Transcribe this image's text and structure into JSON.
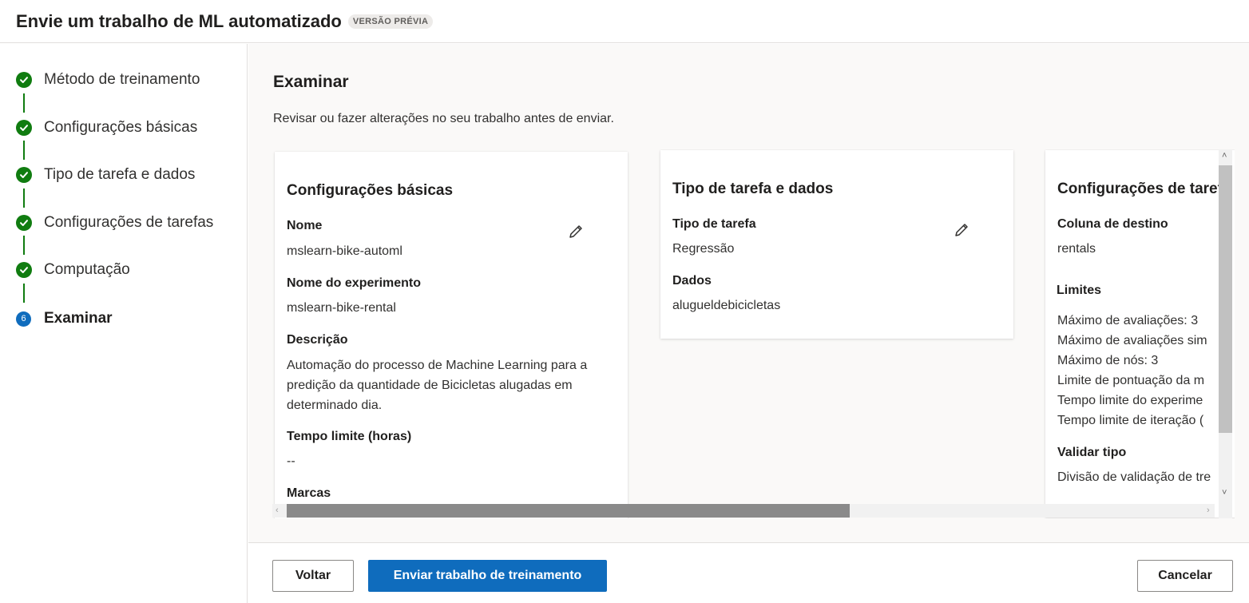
{
  "header": {
    "title": "Envie um trabalho de ML automatizado",
    "badge": "VERSÃO PRÉVIA"
  },
  "steps": [
    {
      "label": "Método de treinamento",
      "status": "done"
    },
    {
      "label": "Configurações básicas",
      "status": "done"
    },
    {
      "label": "Tipo de tarefa e dados",
      "status": "done"
    },
    {
      "label": "Configurações de tarefas",
      "status": "done"
    },
    {
      "label": "Computação",
      "status": "done"
    },
    {
      "label": "Examinar",
      "status": "current",
      "number": "6"
    }
  ],
  "main": {
    "title": "Examinar",
    "subtitle": "Revisar ou fazer alterações no seu trabalho antes de enviar."
  },
  "cards": {
    "basic": {
      "title": "Configurações básicas",
      "name_label": "Nome",
      "name_value": "mslearn-bike-automl",
      "experiment_label": "Nome do experimento",
      "experiment_value": "mslearn-bike-rental",
      "description_label": "Descrição",
      "description_value": "Automação do processo de Machine Learning para a predição da quantidade de Bicicletas alugadas em determinado dia.",
      "timeout_label": "Tempo limite (horas)",
      "timeout_value": "--",
      "tags_label": "Marcas"
    },
    "task": {
      "title": "Tipo de tarefa e dados",
      "type_label": "Tipo de tarefa",
      "type_value": "Regressão",
      "data_label": "Dados",
      "data_value": "alugueldebicicletas"
    },
    "settings": {
      "title": "Configurações de taref",
      "target_label": "Coluna de destino",
      "target_value": "rentals",
      "limits_label": "Limites",
      "limits": [
        "Máximo de avaliações: 3",
        "Máximo de avaliações sim",
        "Máximo de nós: 3",
        "Limite de pontuação da m",
        "Tempo limite do experime",
        "Tempo limite de iteração ("
      ],
      "validation_label": "Validar tipo",
      "validation_value": "Divisão de validação de tre"
    }
  },
  "footer": {
    "back_label": "Voltar",
    "submit_label": "Enviar trabalho de treinamento",
    "cancel_label": "Cancelar"
  },
  "colors": {
    "done": "#107c10",
    "primary": "#0f6cbd"
  }
}
